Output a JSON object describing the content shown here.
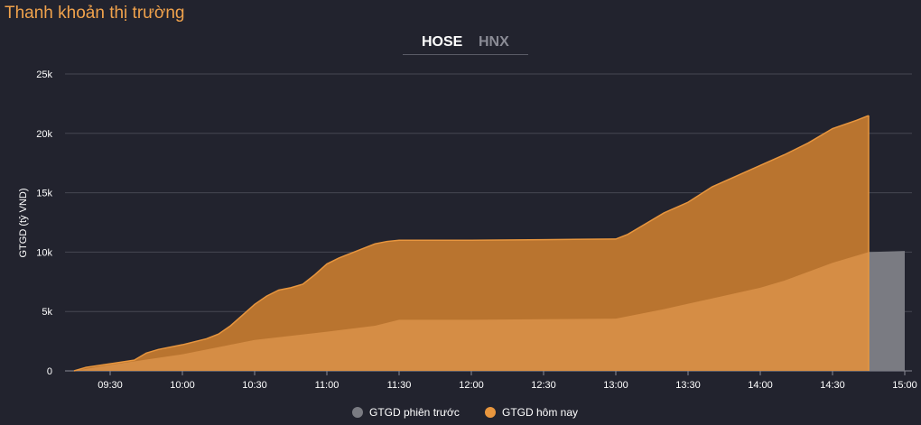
{
  "title": "Thanh khoản thị trường",
  "tabs": {
    "active": "HOSE",
    "inactive": "HNX"
  },
  "legend": {
    "previous": {
      "label": "GTGD phiên trước",
      "color": "#7a7b82"
    },
    "today": {
      "label": "GTGD hôm nay",
      "color": "#e8963e"
    }
  },
  "chart_data": {
    "type": "area",
    "ylabel": "GTGD (tỷ VND)",
    "ylim": [
      0,
      25000
    ],
    "y_ticks": [
      {
        "v": 0,
        "label": "0"
      },
      {
        "v": 5000,
        "label": "5k"
      },
      {
        "v": 10000,
        "label": "10k"
      },
      {
        "v": 15000,
        "label": "15k"
      },
      {
        "v": 20000,
        "label": "20k"
      },
      {
        "v": 25000,
        "label": "25k"
      }
    ],
    "x_ticks": [
      "09:30",
      "10:00",
      "10:30",
      "11:00",
      "11:30",
      "12:00",
      "12:30",
      "13:00",
      "13:30",
      "14:00",
      "14:30",
      "15:00"
    ],
    "x_range": [
      "09:15",
      "15:00"
    ],
    "grid": true,
    "legend_position": "bottom",
    "series": [
      {
        "name": "GTGD hôm nay",
        "color": "#e8963e",
        "points": [
          [
            "09:15",
            0
          ],
          [
            "09:20",
            300
          ],
          [
            "09:30",
            600
          ],
          [
            "09:40",
            900
          ],
          [
            "09:45",
            1500
          ],
          [
            "09:50",
            1800
          ],
          [
            "10:00",
            2200
          ],
          [
            "10:10",
            2700
          ],
          [
            "10:15",
            3100
          ],
          [
            "10:20",
            3800
          ],
          [
            "10:25",
            4700
          ],
          [
            "10:30",
            5600
          ],
          [
            "10:35",
            6300
          ],
          [
            "10:40",
            6800
          ],
          [
            "10:45",
            7000
          ],
          [
            "10:50",
            7300
          ],
          [
            "10:55",
            8100
          ],
          [
            "11:00",
            9000
          ],
          [
            "11:05",
            9500
          ],
          [
            "11:10",
            9900
          ],
          [
            "11:15",
            10300
          ],
          [
            "11:20",
            10700
          ],
          [
            "11:25",
            10900
          ],
          [
            "11:30",
            11000
          ],
          [
            "12:00",
            11000
          ],
          [
            "12:30",
            11050
          ],
          [
            "13:00",
            11100
          ],
          [
            "13:05",
            11500
          ],
          [
            "13:10",
            12100
          ],
          [
            "13:20",
            13300
          ],
          [
            "13:30",
            14200
          ],
          [
            "13:40",
            15500
          ],
          [
            "13:50",
            16400
          ],
          [
            "14:00",
            17300
          ],
          [
            "14:10",
            18200
          ],
          [
            "14:20",
            19200
          ],
          [
            "14:30",
            20400
          ],
          [
            "14:40",
            21100
          ],
          [
            "14:45",
            21500
          ]
        ]
      },
      {
        "name": "GTGD phiên trước",
        "color": "#7a7b82",
        "points": [
          [
            "09:15",
            0
          ],
          [
            "09:30",
            500
          ],
          [
            "10:00",
            1400
          ],
          [
            "10:30",
            2600
          ],
          [
            "11:00",
            3300
          ],
          [
            "11:20",
            3800
          ],
          [
            "11:30",
            4300
          ],
          [
            "12:00",
            4300
          ],
          [
            "12:30",
            4350
          ],
          [
            "13:00",
            4400
          ],
          [
            "13:20",
            5200
          ],
          [
            "13:40",
            6100
          ],
          [
            "14:00",
            7000
          ],
          [
            "14:10",
            7600
          ],
          [
            "14:30",
            9100
          ],
          [
            "14:45",
            10000
          ],
          [
            "15:00",
            10100
          ]
        ]
      }
    ]
  }
}
